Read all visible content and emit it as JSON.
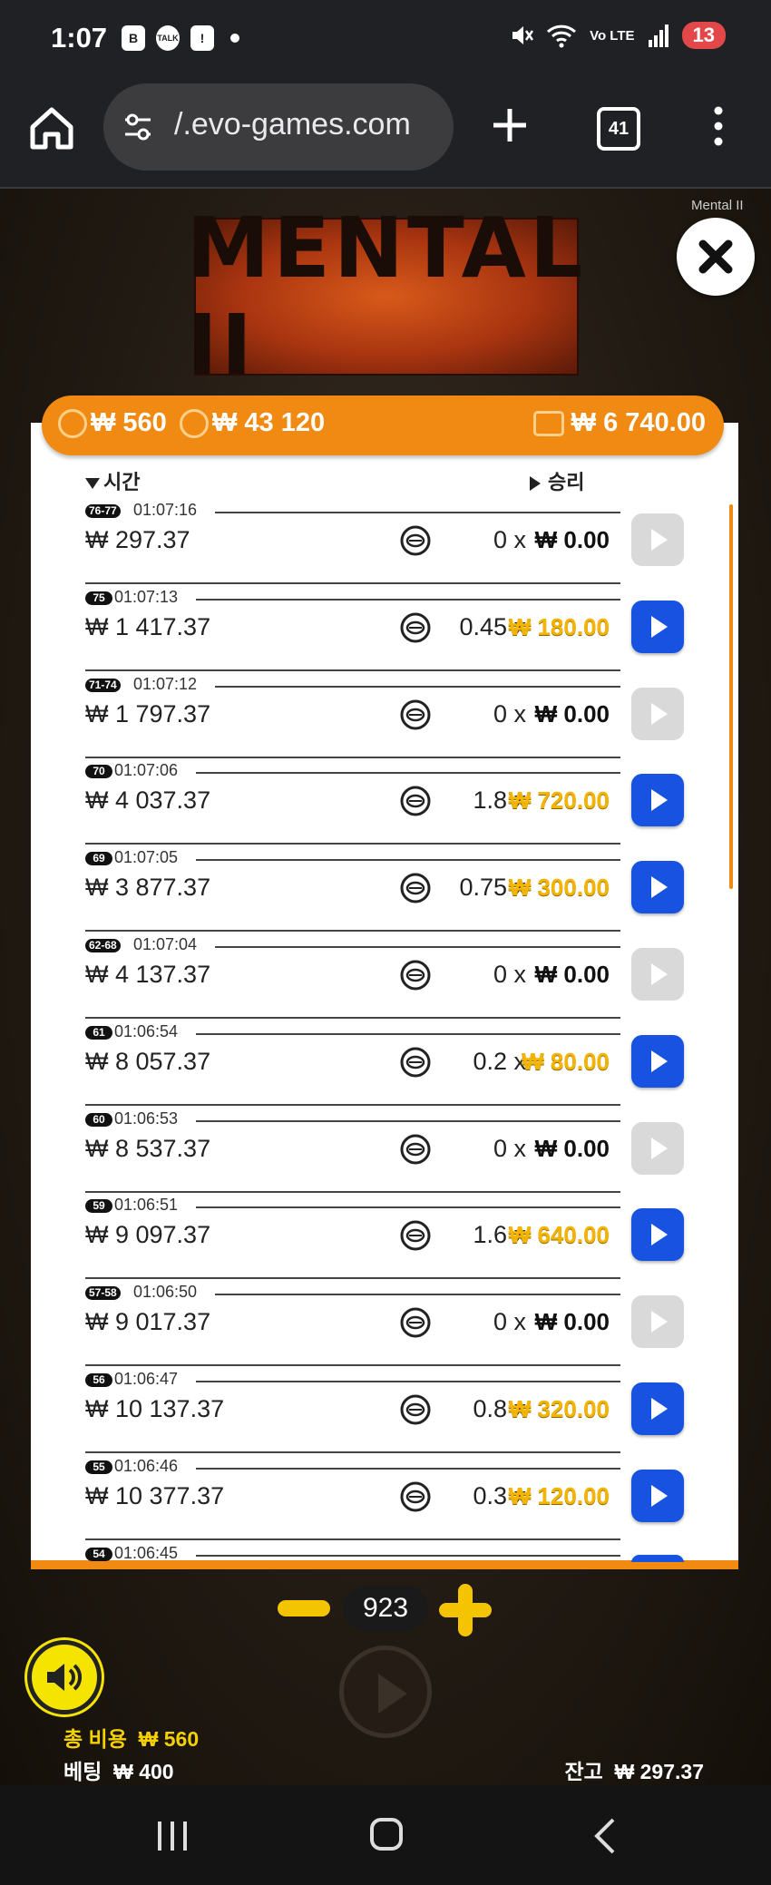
{
  "status_bar": {
    "time": "1:07",
    "notif_b": "B",
    "notif_talk": "TALK",
    "notif_alert": "!",
    "network": "Vo LTE",
    "battery": "13"
  },
  "browser": {
    "url": "/.evo-games.com",
    "tab_count": "41"
  },
  "game": {
    "logo_text": "MENTAL II",
    "name": "Mental II"
  },
  "header": {
    "cost": "₩ 560",
    "coins": "₩ 43 120",
    "wallet": "₩ 6 740.00"
  },
  "columns": {
    "time_label": "시간",
    "win_label": "승리"
  },
  "history": [
    {
      "round": "76-77",
      "time": "01:07:16",
      "balance": "₩ 297.37",
      "multiplier": "0 x",
      "win": "₩ 0.00",
      "has_win": false
    },
    {
      "round": "75",
      "time": "01:07:13",
      "balance": "₩ 1 417.37",
      "multiplier": "0.45 x",
      "win": "₩ 180.00",
      "has_win": true
    },
    {
      "round": "71-74",
      "time": "01:07:12",
      "balance": "₩ 1 797.37",
      "multiplier": "0 x",
      "win": "₩ 0.00",
      "has_win": false
    },
    {
      "round": "70",
      "time": "01:07:06",
      "balance": "₩ 4 037.37",
      "multiplier": "1.8 x",
      "win": "₩ 720.00",
      "has_win": true
    },
    {
      "round": "69",
      "time": "01:07:05",
      "balance": "₩ 3 877.37",
      "multiplier": "0.75 x",
      "win": "₩ 300.00",
      "has_win": true
    },
    {
      "round": "62-68",
      "time": "01:07:04",
      "balance": "₩ 4 137.37",
      "multiplier": "0 x",
      "win": "₩ 0.00",
      "has_win": false
    },
    {
      "round": "61",
      "time": "01:06:54",
      "balance": "₩ 8 057.37",
      "multiplier": "0.2 x",
      "win": "₩ 80.00",
      "has_win": true
    },
    {
      "round": "60",
      "time": "01:06:53",
      "balance": "₩ 8 537.37",
      "multiplier": "0 x",
      "win": "₩ 0.00",
      "has_win": false
    },
    {
      "round": "59",
      "time": "01:06:51",
      "balance": "₩ 9 097.37",
      "multiplier": "1.6 x",
      "win": "₩ 640.00",
      "has_win": true
    },
    {
      "round": "57-58",
      "time": "01:06:50",
      "balance": "₩ 9 017.37",
      "multiplier": "0 x",
      "win": "₩ 0.00",
      "has_win": false
    },
    {
      "round": "56",
      "time": "01:06:47",
      "balance": "₩ 10 137.37",
      "multiplier": "0.8 x",
      "win": "₩ 320.00",
      "has_win": true
    },
    {
      "round": "55",
      "time": "01:06:46",
      "balance": "₩ 10 377.37",
      "multiplier": "0.3 x",
      "win": "₩ 120.00",
      "has_win": true
    },
    {
      "round": "54",
      "time": "01:06:45",
      "balance": "",
      "multiplier": "",
      "win": "",
      "has_win": true
    }
  ],
  "controls": {
    "count": "923"
  },
  "footer": {
    "total_cost_label": "총 비용",
    "total_cost": "₩ 560",
    "bet_label": "베팅",
    "bet": "₩ 400",
    "balance_label": "잔고",
    "balance": "₩ 297.37"
  },
  "colors": {
    "accent": "#f08a12",
    "play_active": "#1753e0",
    "win_gold": "#f5b400"
  }
}
